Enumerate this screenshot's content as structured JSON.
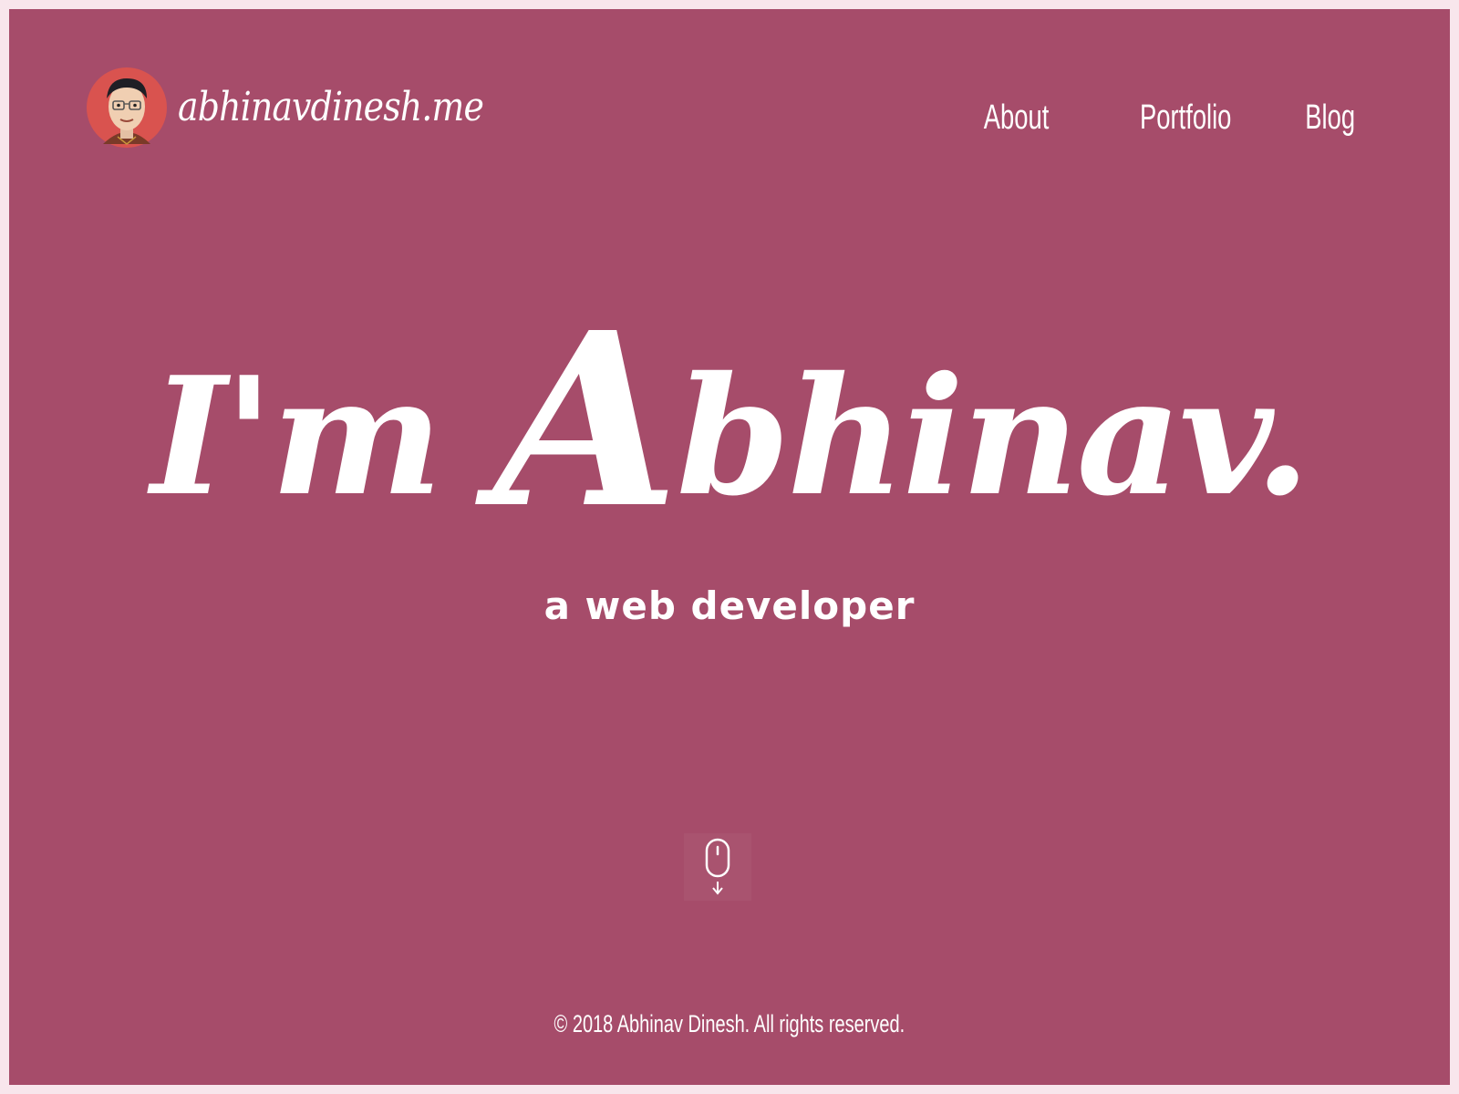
{
  "header": {
    "brand_text": "abhinavdinesh.me",
    "avatar_icon": "developer-avatar-icon"
  },
  "nav": {
    "items": [
      {
        "label": "About"
      },
      {
        "label": "Portfolio"
      },
      {
        "label": "Blog"
      }
    ]
  },
  "hero": {
    "title_prefix": "I'm ",
    "title_cap": "A",
    "title_rest": "bhinav.",
    "subtitle": "a web developer"
  },
  "scroll": {
    "icon": "mouse-scroll-down-icon"
  },
  "footer": {
    "copyright": "© 2018 Abhinav Dinesh. All rights reserved."
  },
  "colors": {
    "background": "#a64c6a",
    "outer": "#f8e6ec",
    "text": "#ffffff",
    "avatar_bg": "#d9534f"
  }
}
